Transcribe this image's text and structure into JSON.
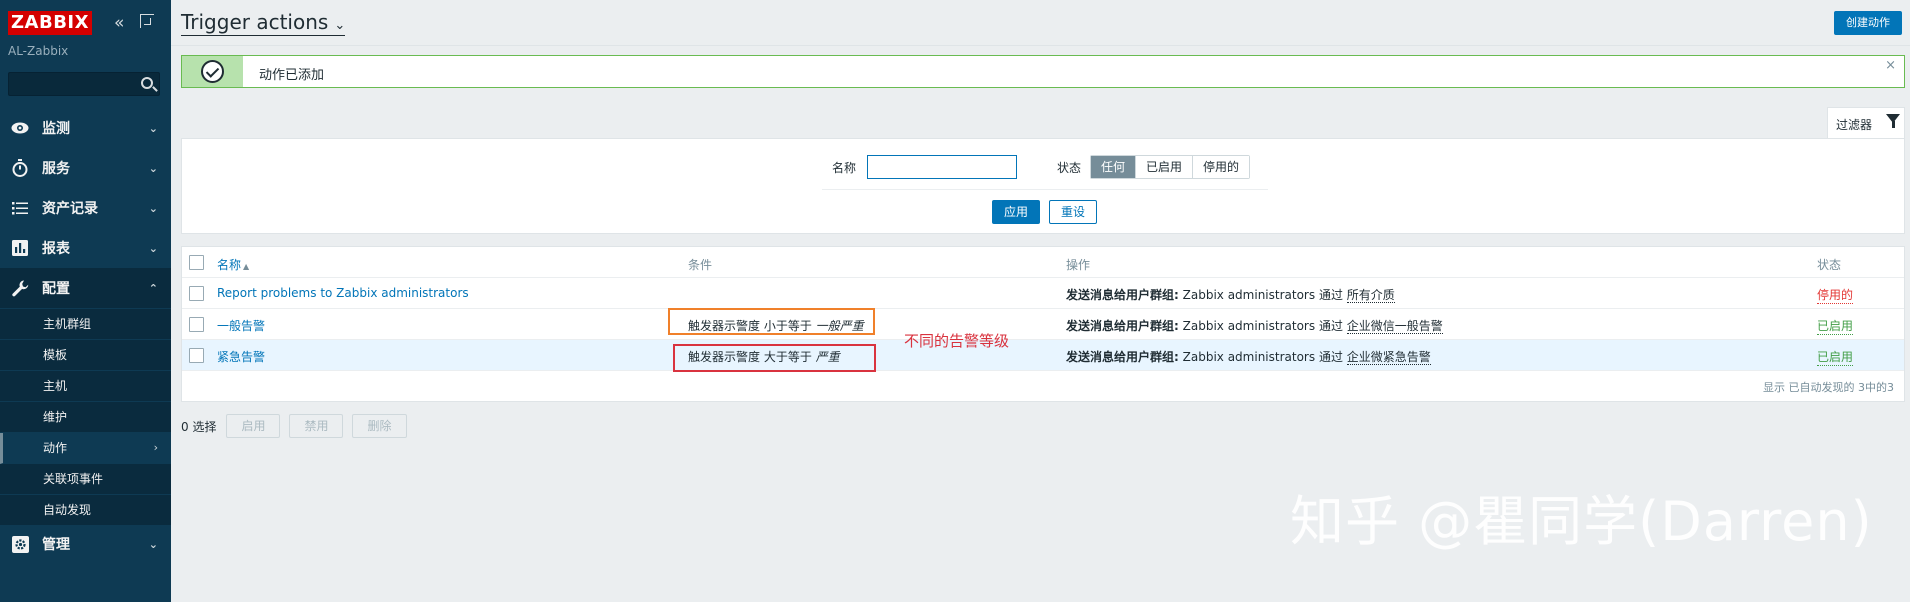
{
  "sidebar": {
    "logo": "ZABBIX",
    "server_name": "AL-Zabbix",
    "search": {
      "value": "",
      "placeholder": ""
    },
    "menu": [
      {
        "label": "监测",
        "icon": "eye-icon"
      },
      {
        "label": "服务",
        "icon": "stopwatch-icon"
      },
      {
        "label": "资产记录",
        "icon": "list-icon"
      },
      {
        "label": "报表",
        "icon": "bar-chart-icon"
      },
      {
        "label": "配置",
        "icon": "wrench-icon"
      },
      {
        "label": "管理",
        "icon": "gear-icon"
      }
    ],
    "submenu": [
      {
        "label": "主机群组"
      },
      {
        "label": "模板"
      },
      {
        "label": "主机"
      },
      {
        "label": "维护"
      },
      {
        "label": "动作"
      },
      {
        "label": "关联项事件"
      },
      {
        "label": "自动发现"
      }
    ]
  },
  "header": {
    "title": "Trigger actions",
    "create_button": "创建动作"
  },
  "message": {
    "text": "动作已添加",
    "close": "×"
  },
  "filter": {
    "tab_label": "过滤器",
    "name_label": "名称",
    "name_value": "",
    "status_label": "状态",
    "status_options": [
      "任何",
      "已启用",
      "停用的"
    ],
    "status_selected": "任何",
    "apply": "应用",
    "reset": "重设"
  },
  "table": {
    "headers": {
      "name": "名称",
      "conditions": "条件",
      "operations": "操作",
      "status": "状态"
    },
    "rows": [
      {
        "name": "Report problems to Zabbix administrators",
        "condition_prefix": "",
        "condition_value": "",
        "op_label": "发送消息给用户群组:",
        "op_group": "Zabbix administrators",
        "op_via": "通过",
        "op_media": "所有介质",
        "status": "停用的"
      },
      {
        "name": "一般告警",
        "condition_prefix": "触发器示警度 小于等于",
        "condition_value": "一般严重",
        "op_label": "发送消息给用户群组:",
        "op_group": "Zabbix administrators",
        "op_via": "通过",
        "op_media": "企业微信一般告警",
        "status": "已启用"
      },
      {
        "name": "紧急告警",
        "condition_prefix": "触发器示警度 大于等于",
        "condition_value": "严重",
        "op_label": "发送消息给用户群组:",
        "op_group": "Zabbix administrators",
        "op_via": "通过",
        "op_media": "企业微紧急告警",
        "status": "已启用"
      }
    ],
    "footer": "显示 已自动发现的 3中的3"
  },
  "annotation": {
    "label": "不同的告警等级"
  },
  "bottom": {
    "selected": "0 选择",
    "enable": "启用",
    "disable": "禁用",
    "delete": "删除"
  },
  "watermark": "知乎 @瞿同学(Darren)",
  "colors": {
    "sidebar_bg": "#0e3a53",
    "accent": "#0275b8",
    "logo_red": "#d40000",
    "status_disabled": "#e33734",
    "status_enabled": "#429e47"
  }
}
